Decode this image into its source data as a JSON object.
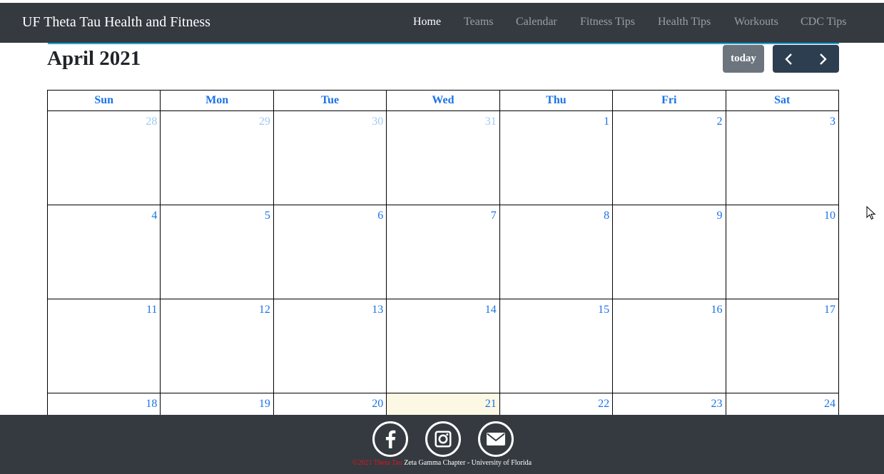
{
  "navbar": {
    "brand": "UF Theta Tau Health and Fitness",
    "links": [
      {
        "label": "Home",
        "active": true
      },
      {
        "label": "Teams"
      },
      {
        "label": "Calendar"
      },
      {
        "label": "Fitness Tips"
      },
      {
        "label": "Health Tips"
      },
      {
        "label": "Workouts"
      },
      {
        "label": "CDC Tips"
      }
    ]
  },
  "calendar": {
    "title": "April 2021",
    "today_label": "today",
    "weekdays": [
      "Sun",
      "Mon",
      "Tue",
      "Wed",
      "Thu",
      "Fri",
      "Sat"
    ],
    "weeks": [
      [
        "28",
        "29",
        "30",
        "31",
        "1",
        "2",
        "3"
      ],
      [
        "4",
        "5",
        "6",
        "7",
        "8",
        "9",
        "10"
      ],
      [
        "11",
        "12",
        "13",
        "14",
        "15",
        "16",
        "17"
      ],
      [
        "18",
        "19",
        "20",
        "21",
        "22",
        "23",
        "24"
      ]
    ],
    "other_month_days": [
      "28",
      "29",
      "30",
      "31"
    ],
    "today_day": "21",
    "colors": {
      "day_number": "#1a73e8",
      "today_bg": "#fcf8e3",
      "accent": "#1fa3d6"
    }
  },
  "footer": {
    "icons": [
      "facebook-icon",
      "instagram-icon",
      "email-icon"
    ],
    "copyright_red": "©2021 Theta Tau",
    "copyright_white": " Zeta Gamma Chapter - University of Florida"
  }
}
